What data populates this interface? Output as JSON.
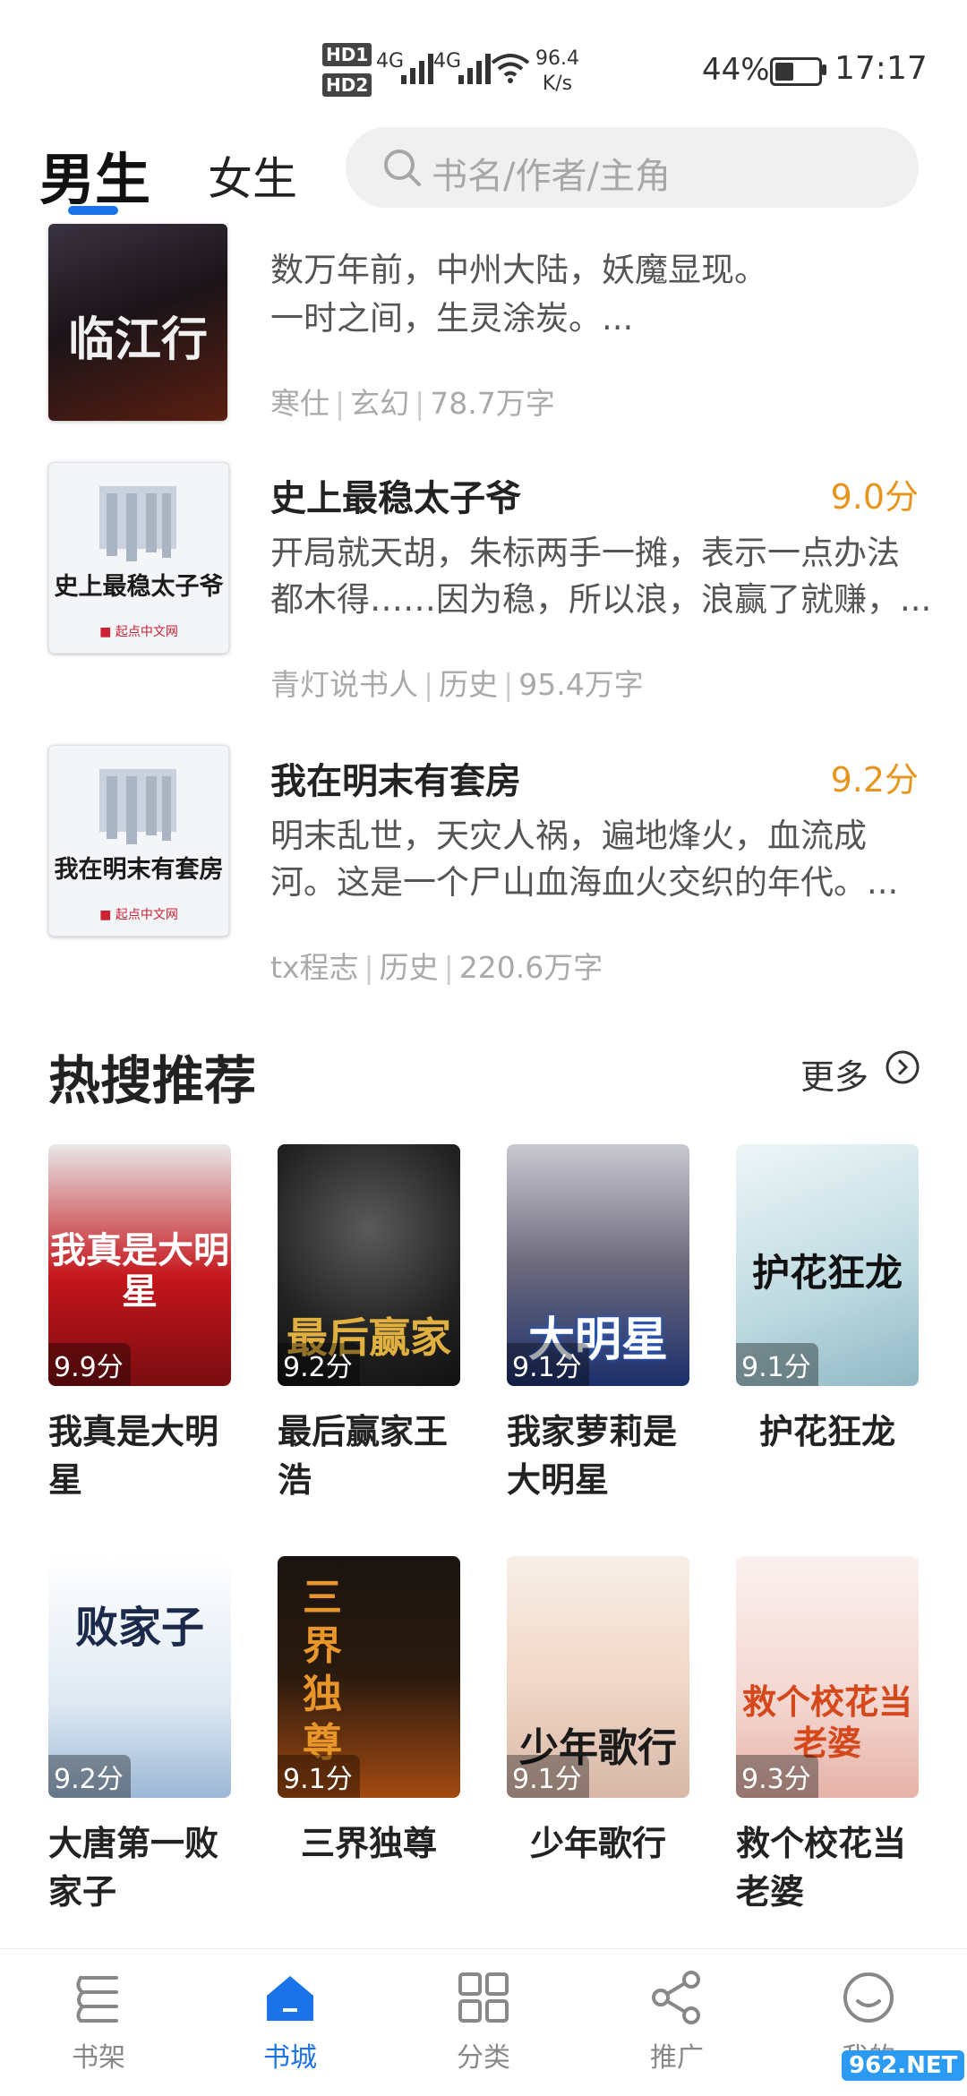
{
  "status_bar": {
    "hd1": "HD1",
    "hd2": "HD2",
    "net1": "4G",
    "net2": "4G",
    "speed_value": "96.4",
    "speed_unit": "K/s",
    "battery": "44%",
    "time": "17:17"
  },
  "header": {
    "tab_male": "男生",
    "tab_female": "女生",
    "search_placeholder": "书名/作者/主角"
  },
  "books": [
    {
      "cover_text": "临江行",
      "title": "",
      "score": "",
      "desc1": "数万年前，中州大陆，妖魔显现。",
      "desc2": "一时之间，生灵涂炭。...",
      "author": "寒仕",
      "category": "玄幻",
      "words": "78.7万字"
    },
    {
      "cover_text": "史上最稳太子爷",
      "title": "史上最稳太子爷",
      "score": "9.0分",
      "desc1": "开局就天胡，朱标两手一摊，表示一点办法",
      "desc2": "都木得……因为稳，所以浪，浪赢了就赚，...",
      "author": "青灯说书人",
      "category": "历史",
      "words": "95.4万字"
    },
    {
      "cover_text": "我在明末有套房",
      "title": "我在明末有套房",
      "score": "9.2分",
      "desc1": "明末乱世，天灾人祸，遍地烽火，血流成",
      "desc2": "河。这是一个尸山血海血火交织的年代。...",
      "author": "tx程志",
      "category": "历史",
      "words": "220.6万字"
    }
  ],
  "hot": {
    "title": "热搜推荐",
    "more": "更多",
    "items": [
      {
        "title": "我真是大明星",
        "score": "9.9分",
        "cover_text": "我真是大明星"
      },
      {
        "title": "最后赢家王浩",
        "score": "9.2分",
        "cover_text": "最后赢家"
      },
      {
        "title": "我家萝莉是大明星",
        "score": "9.1分",
        "cover_text": "大明星"
      },
      {
        "title": "护花狂龙",
        "score": "9.1分",
        "cover_text": "护花狂龙"
      },
      {
        "title": "大唐第一败家子",
        "score": "9.2分",
        "cover_text": "败家子"
      },
      {
        "title": "三界独尊",
        "score": "9.1分",
        "cover_text": "三界独尊"
      },
      {
        "title": "少年歌行",
        "score": "9.1分",
        "cover_text": "少年歌行"
      },
      {
        "title": "救个校花当老婆",
        "score": "9.3分",
        "cover_text": "救个校花当老婆"
      }
    ]
  },
  "nav": {
    "shelf": "书架",
    "store": "书城",
    "category": "分类",
    "promote": "推广",
    "mine": "我的"
  },
  "watermark": "962.NET"
}
